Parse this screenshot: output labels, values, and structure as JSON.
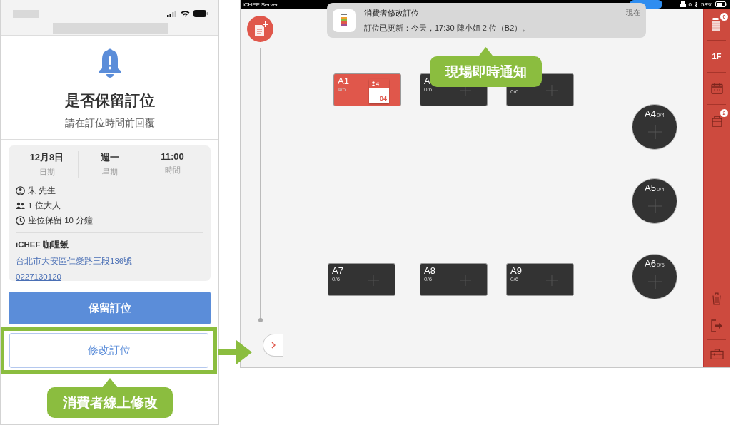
{
  "phone": {
    "alert": {
      "title": "是否保留訂位",
      "subtitle": "請在訂位時間前回覆"
    },
    "summary": [
      {
        "value": "12月8日",
        "label": "日期"
      },
      {
        "value": "週一",
        "label": "星期"
      },
      {
        "value": "11:00",
        "label": "時間"
      }
    ],
    "details": [
      {
        "kind": "guest",
        "text": "朱 先生"
      },
      {
        "kind": "party",
        "text": "1 位大人"
      },
      {
        "kind": "hold",
        "text": "座位保留 10 分鐘"
      }
    ],
    "restaurant": {
      "name": "iCHEF 咖哩飯",
      "address": "台北市大安區仁愛路三段136號",
      "phone": "0227130120"
    },
    "buttons": [
      {
        "label": "保留訂位",
        "kind": "primary",
        "highlighted": false
      },
      {
        "label": "修改訂位",
        "kind": "secondary",
        "highlighted": true
      }
    ],
    "callout": "消費者線上修改"
  },
  "tablet": {
    "status_bar": {
      "app": "iCHEF Server",
      "printer_count": "0",
      "battery": "58%"
    },
    "notification": {
      "title": "消費者修改訂位",
      "body": "訂位已更新：今天，17:30 陳小姐 2 位（B2）。",
      "time": "現在"
    },
    "callout": "現場即時通知",
    "tables": [
      {
        "kind": "rect",
        "label": "A1",
        "occupancy": "4/6",
        "occupied": true,
        "order": {
          "guests": "4",
          "number": "04"
        }
      },
      {
        "kind": "rect",
        "label": "A",
        "occupancy": "0/6",
        "occupied": false
      },
      {
        "kind": "rect",
        "occupancy": "0/6",
        "occupied": false
      },
      {
        "kind": "round",
        "label": "A4",
        "occupancy": "0/4",
        "occupied": false
      },
      {
        "kind": "round",
        "label": "A5",
        "occupancy": "0/4",
        "occupied": false
      },
      {
        "kind": "round",
        "label": "A6",
        "occupancy": "0/6",
        "occupied": false
      },
      {
        "kind": "rect",
        "label": "A7",
        "occupancy": "0/6",
        "occupied": false
      },
      {
        "kind": "rect",
        "label": "A8",
        "occupancy": "0/6",
        "occupied": false
      },
      {
        "kind": "rect",
        "label": "A9",
        "occupancy": "0/6",
        "occupied": false
      }
    ],
    "sidebar": {
      "top_items": [
        {
          "kind": "orders",
          "badge": "0"
        },
        {
          "kind": "floor",
          "label": "1F"
        },
        {
          "kind": "calendar"
        },
        {
          "kind": "bag",
          "badge": "2"
        }
      ],
      "bottom_items": [
        {
          "kind": "trash"
        },
        {
          "kind": "exit"
        },
        {
          "kind": "toolbox"
        }
      ]
    }
  }
}
